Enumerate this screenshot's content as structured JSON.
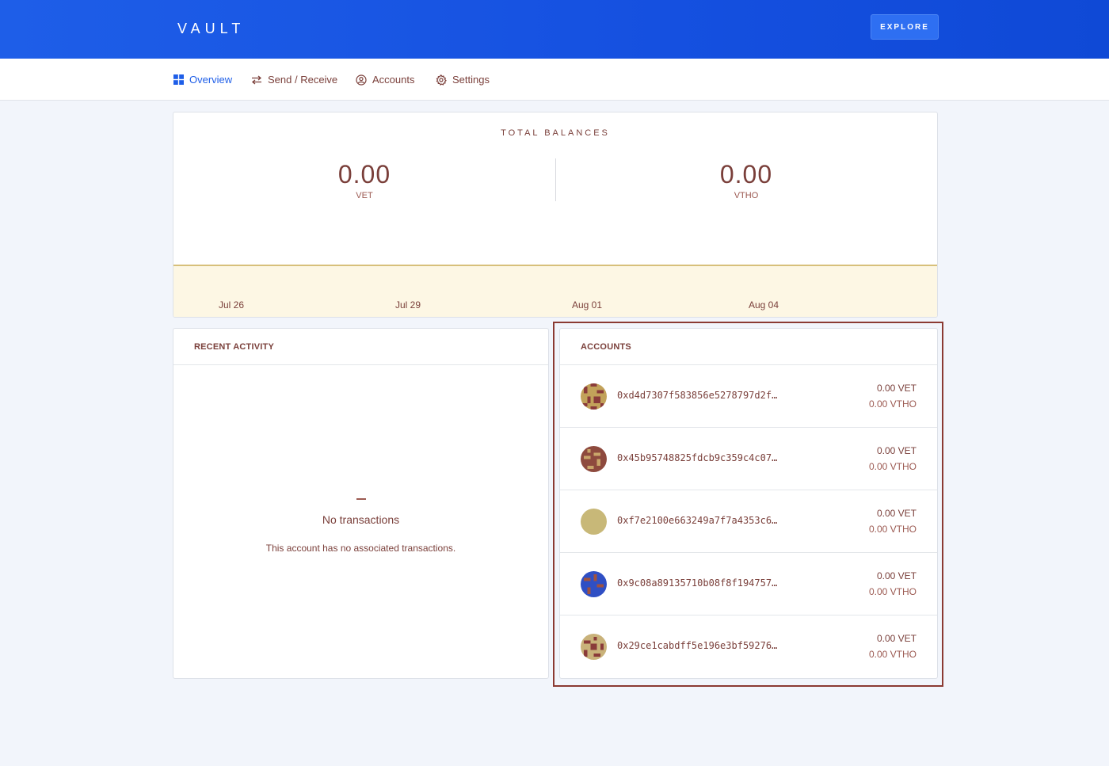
{
  "header": {
    "brand": "VAULT",
    "explore_label": "EXPLORE"
  },
  "tabs": [
    {
      "label": "Overview",
      "icon": "grid-icon",
      "active": true
    },
    {
      "label": "Send / Receive",
      "icon": "swap-arrows-icon",
      "active": false
    },
    {
      "label": "Accounts",
      "icon": "user-circle-icon",
      "active": false
    },
    {
      "label": "Settings",
      "icon": "gear-icon",
      "active": false
    }
  ],
  "balances": {
    "title": "TOTAL BALANCES",
    "vet": {
      "amount": "0.00",
      "unit": "VET"
    },
    "vtho": {
      "amount": "0.00",
      "unit": "VTHO"
    },
    "chart_ticks": [
      "Jul 26",
      "Jul 29",
      "Aug 01",
      "Aug 04"
    ]
  },
  "activity": {
    "title": "RECENT ACTIVITY",
    "empty_title": "No transactions",
    "empty_desc": "This account has no associated transactions."
  },
  "accounts": {
    "title": "ACCOUNTS",
    "items": [
      {
        "address": "0xd4d7307f583856e5278797d2f…",
        "vet": "0.00 VET",
        "vtho": "0.00 VTHO",
        "avatar_colors": [
          "#c2a25a",
          "#8a3b3a"
        ]
      },
      {
        "address": "0x45b95748825fdcb9c359c4c07…",
        "vet": "0.00 VET",
        "vtho": "0.00 VTHO",
        "avatar_colors": [
          "#8e4a3e",
          "#c9a56a"
        ]
      },
      {
        "address": "0xf7e2100e663249a7f7a4353c6…",
        "vet": "0.00 VET",
        "vtho": "0.00 VTHO",
        "avatar_colors": [
          "#c8b878",
          "#c8b878"
        ]
      },
      {
        "address": "0x9c08a89135710b08f8f194757…",
        "vet": "0.00 VET",
        "vtho": "0.00 VTHO",
        "avatar_colors": [
          "#2f4fc4",
          "#a0523e"
        ]
      },
      {
        "address": "0x29ce1cabdff5e196e3bf59276…",
        "vet": "0.00 VET",
        "vtho": "0.00 VTHO",
        "avatar_colors": [
          "#c9b27a",
          "#8a3b3a"
        ]
      }
    ]
  },
  "colors": {
    "brand_blue": "#1e5ee8",
    "text_brown": "#7a3f3a",
    "chart_fill": "#fdf7e4",
    "chart_line": "#d7c07a",
    "highlight_border": "#8b3a32"
  }
}
